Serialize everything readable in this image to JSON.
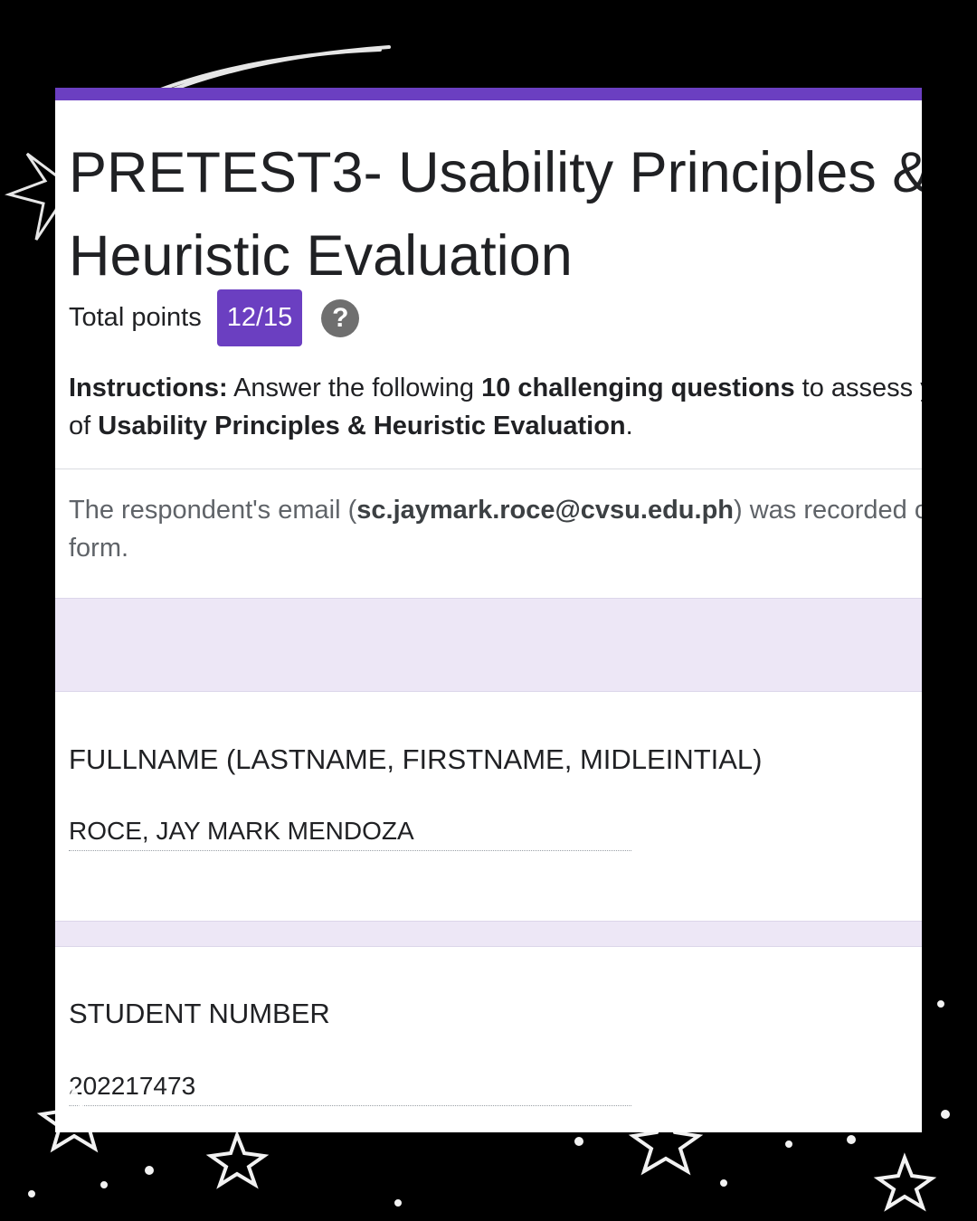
{
  "form": {
    "title": "PRETEST3- Usability Principles &\nHeuristic Evaluation",
    "total_points_label": "Total points",
    "score": "12/15",
    "help_icon": "help-icon",
    "help_glyph": "?",
    "instructions": {
      "lead": "Instructions:",
      "part1": " Answer the following ",
      "bold1": "10 challenging questions",
      "part2": " to assess your understanding",
      "part3": "of ",
      "bold2": "Usability Principles & Heuristic Evaluation",
      "part4": "."
    },
    "email_note": {
      "prefix": "The respondent's email (",
      "email": "sc.jaymark.roce@cvsu.edu.ph",
      "suffix": ") was recorded on submission of this",
      "line2": "form."
    }
  },
  "questions": [
    {
      "title": "FULLNAME (LASTNAME, FIRSTNAME, MIDLEINTIAL)",
      "answer": "ROCE, JAY MARK MENDOZA"
    },
    {
      "title": "STUDENT NUMBER",
      "answer": "202217473"
    }
  ],
  "colors": {
    "accent": "#6b3fc1",
    "section_band": "#ede7f6",
    "background": "#000000"
  }
}
